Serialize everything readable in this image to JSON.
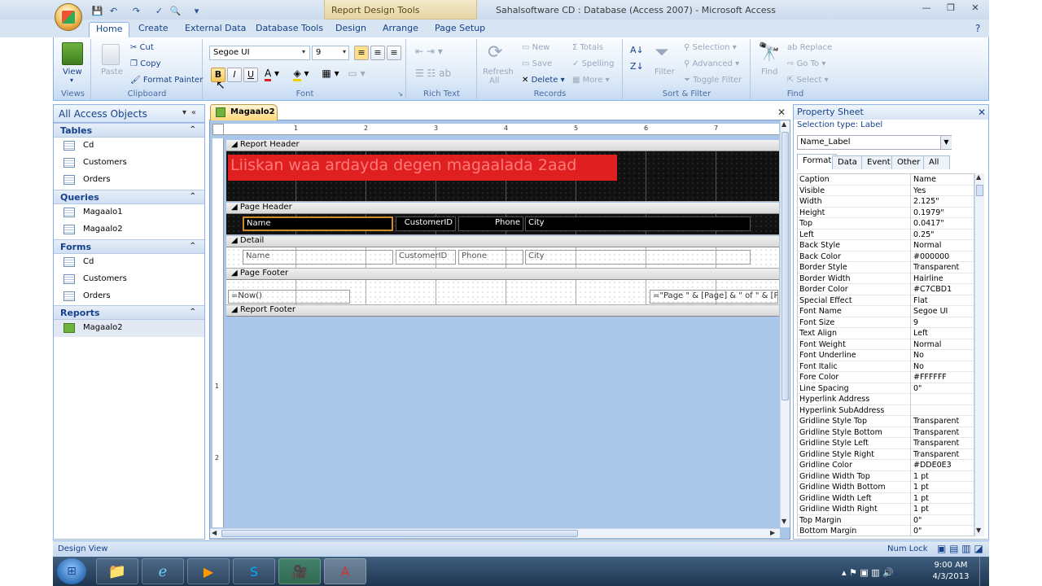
{
  "window": {
    "title": "Sahalsoftware CD : Database (Access 2007)  -  Microsoft Access",
    "context_tab": "Report Design Tools"
  },
  "tabs": [
    "Home",
    "Create",
    "External Data",
    "Database Tools",
    "Design",
    "Arrange",
    "Page Setup"
  ],
  "ribbon": {
    "views": {
      "label": "Views",
      "view": "View"
    },
    "clipboard": {
      "label": "Clipboard",
      "paste": "Paste",
      "cut": "Cut",
      "copy": "Copy",
      "format_painter": "Format Painter"
    },
    "font": {
      "label": "Font",
      "font_name": "Segoe UI",
      "font_size": "9",
      "bold": "B",
      "italic": "I",
      "underline": "U"
    },
    "rich_text": {
      "label": "Rich Text"
    },
    "records": {
      "label": "Records",
      "refresh": "Refresh",
      "refresh_sub": "All",
      "new": "New",
      "save": "Save",
      "delete": "Delete",
      "totals": "Totals",
      "spelling": "Spelling",
      "more": "More"
    },
    "sort_filter": {
      "label": "Sort & Filter",
      "filter": "Filter",
      "selection": "Selection",
      "advanced": "Advanced",
      "toggle_filter": "Toggle Filter"
    },
    "find": {
      "label": "Find",
      "find": "Find",
      "replace": "Replace",
      "go_to": "Go To",
      "select": "Select"
    }
  },
  "nav": {
    "title": "All Access Objects",
    "sections": [
      {
        "name": "Tables",
        "items": [
          "Cd",
          "Customers",
          "Orders"
        ]
      },
      {
        "name": "Queries",
        "items": [
          "Magaalo1",
          "Magaalo2"
        ]
      },
      {
        "name": "Forms",
        "items": [
          "Cd",
          "Customers",
          "Orders"
        ]
      },
      {
        "name": "Reports",
        "items": [
          "Magaalo2"
        ]
      }
    ]
  },
  "doc": {
    "tab": "Magaalo2",
    "ruler_marks": [
      "1",
      "2",
      "3",
      "4",
      "5",
      "6",
      "7"
    ],
    "ruler_left_marks": [
      "1",
      "2"
    ],
    "sections": {
      "report_header": "Report Header",
      "page_header": "Page Header",
      "detail": "Detail",
      "page_footer": "Page Footer",
      "report_footer": "Report Footer"
    },
    "title_label": "Liiskan waa ardayda degen magaalada 2aad",
    "header_labels": [
      "Name",
      "CustomerID",
      "Phone",
      "City"
    ],
    "detail_fields": [
      "Name",
      "CustomerID",
      "Phone",
      "City"
    ],
    "footer_now": "=Now()",
    "footer_page": "=\"Page \" & [Page] & \" of \" & [Page"
  },
  "property_sheet": {
    "title": "Property Sheet",
    "selection_type": "Selection type:  Label",
    "selected": "Name_Label",
    "tabs": [
      "Format",
      "Data",
      "Event",
      "Other",
      "All"
    ],
    "rows": [
      [
        "Caption",
        "Name"
      ],
      [
        "Visible",
        "Yes"
      ],
      [
        "Width",
        "2.125\""
      ],
      [
        "Height",
        "0.1979\""
      ],
      [
        "Top",
        "0.0417\""
      ],
      [
        "Left",
        "0.25\""
      ],
      [
        "Back Style",
        "Normal"
      ],
      [
        "Back Color",
        "#000000"
      ],
      [
        "Border Style",
        "Transparent"
      ],
      [
        "Border Width",
        "Hairline"
      ],
      [
        "Border Color",
        "#C7CBD1"
      ],
      [
        "Special Effect",
        "Flat"
      ],
      [
        "Font Name",
        "Segoe UI"
      ],
      [
        "Font Size",
        "9"
      ],
      [
        "Text Align",
        "Left"
      ],
      [
        "Font Weight",
        "Normal"
      ],
      [
        "Font Underline",
        "No"
      ],
      [
        "Font Italic",
        "No"
      ],
      [
        "Fore Color",
        "#FFFFFF"
      ],
      [
        "Line Spacing",
        "0\""
      ],
      [
        "Hyperlink Address",
        ""
      ],
      [
        "Hyperlink SubAddress",
        ""
      ],
      [
        "Gridline Style Top",
        "Transparent"
      ],
      [
        "Gridline Style Bottom",
        "Transparent"
      ],
      [
        "Gridline Style Left",
        "Transparent"
      ],
      [
        "Gridline Style Right",
        "Transparent"
      ],
      [
        "Gridline Color",
        "#DDE0E3"
      ],
      [
        "Gridline Width Top",
        "1 pt"
      ],
      [
        "Gridline Width Bottom",
        "1 pt"
      ],
      [
        "Gridline Width Left",
        "1 pt"
      ],
      [
        "Gridline Width Right",
        "1 pt"
      ],
      [
        "Top Margin",
        "0\""
      ],
      [
        "Bottom Margin",
        "0\""
      ]
    ]
  },
  "status": {
    "left": "Design View",
    "num_lock": "Num Lock"
  },
  "taskbar": {
    "time": "9:00 AM",
    "date": "4/3/2013"
  },
  "colors": {
    "title_label_bg": "#e02020",
    "title_label_fg": "#ff6a6a",
    "accent": "#15428b"
  }
}
